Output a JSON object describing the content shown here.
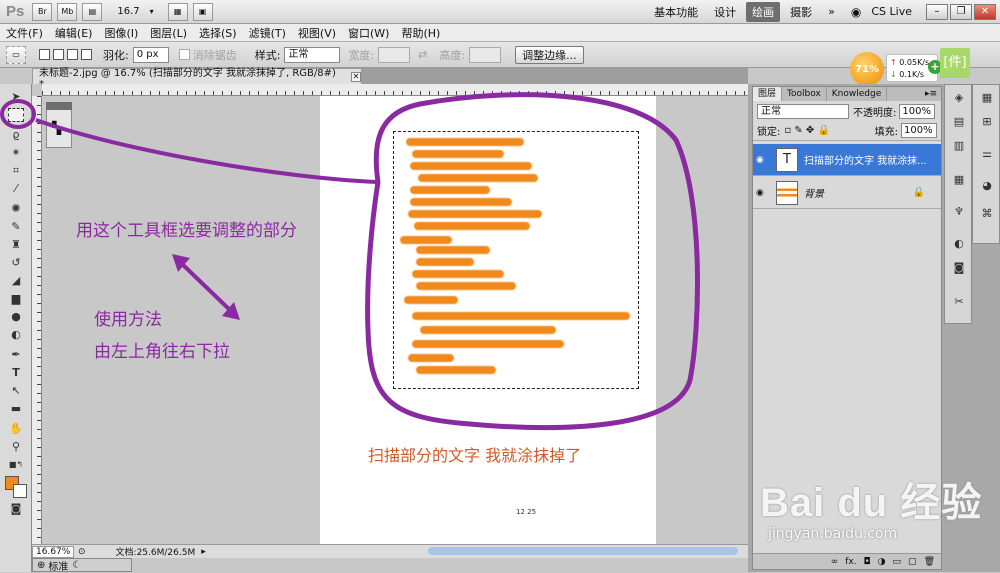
{
  "appbar": {
    "logo": "Ps",
    "br": "Br",
    "mb": "Mb",
    "zoom": "16.7",
    "workspaces": [
      "基本功能",
      "设计",
      "绘画",
      "摄影"
    ],
    "active_workspace": "绘画",
    "more": "»",
    "cslive": "CS Live"
  },
  "menu": [
    "文件(F)",
    "编辑(E)",
    "图像(I)",
    "图层(L)",
    "选择(S)",
    "滤镜(T)",
    "视图(V)",
    "窗口(W)",
    "帮助(H)"
  ],
  "options": {
    "feather_label": "羽化:",
    "feather_value": "0 px",
    "antialias_label": "消除锯齿",
    "style_label": "样式:",
    "style_value": "正常",
    "width_label": "宽度:",
    "height_label": "高度:",
    "refine_button": "调整边缘..."
  },
  "speed": {
    "percent": "71%",
    "up": "0.05K/s",
    "down": "0.1K/s",
    "badge": "[件]"
  },
  "document": {
    "tab_title": "未标题-2.jpg @ 16.7% (扫描部分的文字  我就涂抹掉了, RGB/8#) *",
    "page_number": "12 25"
  },
  "annotations": {
    "tool_note": "用这个工具框选要调整的部分",
    "method_line1": "使用方法",
    "method_line2": "由左上角往右下拉",
    "scan_note": "扫描部分的文字  我就涂抹掉了"
  },
  "status": {
    "zoom": "16.67%",
    "doc_size": "文档:25.6M/26.5M",
    "mode": "标准"
  },
  "layers_panel": {
    "tabs": [
      "图层",
      "Toolbox",
      "Knowledge"
    ],
    "blend_mode": "正常",
    "opacity_label": "不透明度:",
    "opacity": "100%",
    "lock_label": "锁定:",
    "fill_label": "填充:",
    "fill": "100%",
    "layers": [
      {
        "name": "扫描部分的文字  我就涂抹...",
        "thumb": "T"
      },
      {
        "name": "背景",
        "thumb": ""
      }
    ]
  },
  "watermark": {
    "main": "Bai du 经验",
    "url": "jingyan.baidu.com"
  },
  "colors": {
    "annotation_purple": "#8a2aa0",
    "annotation_red": "#d05a2a",
    "orange_marks": "#f08a1c",
    "selected_layer": "#3a78d8"
  }
}
